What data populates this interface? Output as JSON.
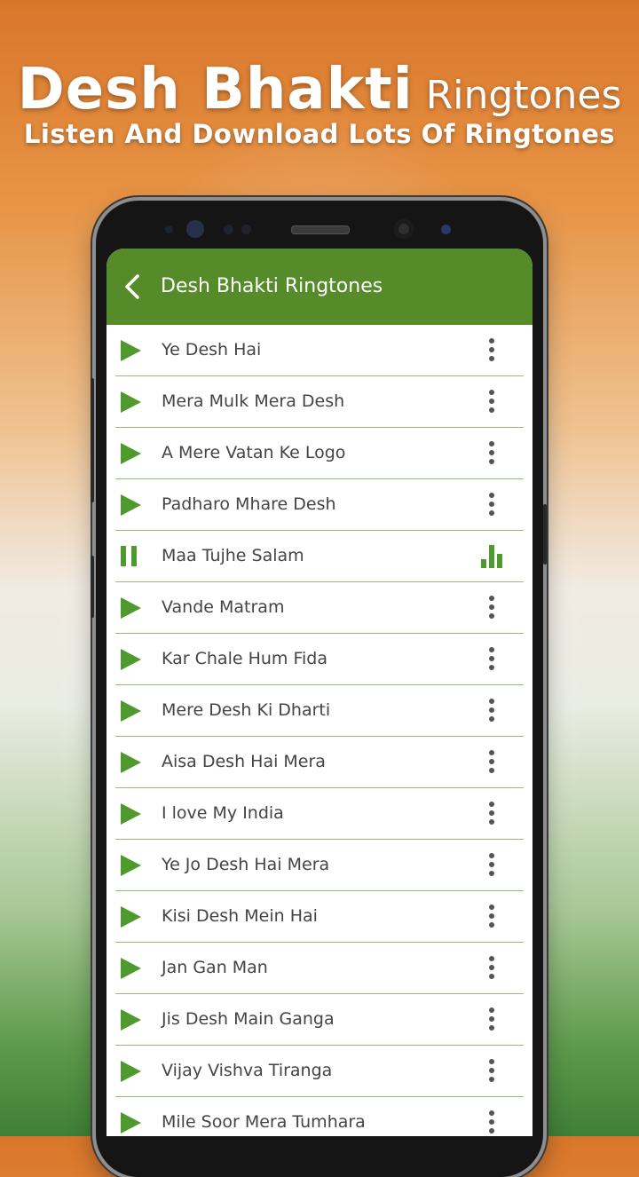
{
  "promo": {
    "title_bold": "Desh Bhakti",
    "title_light": "Ringtones",
    "subtitle": "Listen And Download Lots Of Ringtones"
  },
  "appbar": {
    "title": "Desh Bhakti Ringtones",
    "back_icon": "chevron-left-icon",
    "color": "#568b2a"
  },
  "colors": {
    "accent": "#4f9a2f",
    "divider": "#8fbf72",
    "text": "#444444"
  },
  "ringtones": [
    {
      "title": "Ye Desh Hai",
      "state": "stopped"
    },
    {
      "title": "Mera Mulk Mera Desh",
      "state": "stopped"
    },
    {
      "title": "A Mere Vatan Ke Logo",
      "state": "stopped"
    },
    {
      "title": "Padharo Mhare Desh",
      "state": "stopped"
    },
    {
      "title": "Maa Tujhe Salam",
      "state": "playing"
    },
    {
      "title": "Vande Matram",
      "state": "stopped"
    },
    {
      "title": "Kar Chale Hum Fida",
      "state": "stopped"
    },
    {
      "title": "Mere Desh Ki Dharti",
      "state": "stopped"
    },
    {
      "title": "Aisa Desh Hai Mera",
      "state": "stopped"
    },
    {
      "title": "I  love My India",
      "state": "stopped"
    },
    {
      "title": "Ye Jo Desh Hai Mera",
      "state": "stopped"
    },
    {
      "title": "Kisi Desh Mein Hai",
      "state": "stopped"
    },
    {
      "title": "Jan Gan Man",
      "state": "stopped"
    },
    {
      "title": "Jis Desh Main Ganga",
      "state": "stopped"
    },
    {
      "title": "Vijay Vishva Tiranga",
      "state": "stopped"
    },
    {
      "title": "Mile Soor Mera Tumhara",
      "state": "stopped"
    }
  ]
}
